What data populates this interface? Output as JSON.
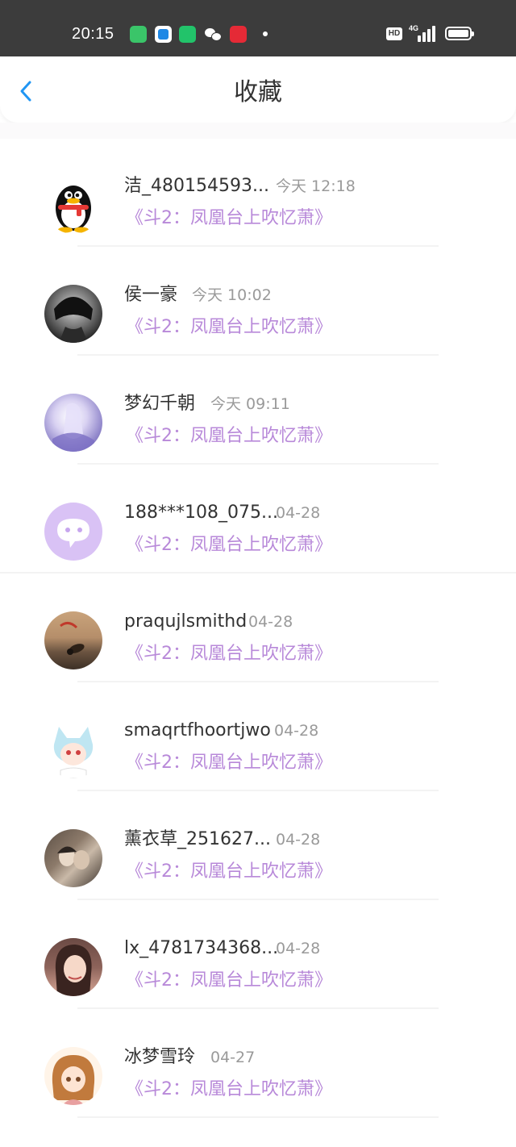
{
  "status_bar": {
    "time": "20:15",
    "hd": "HD",
    "network": "4G",
    "icons": [
      "app-store-icon",
      "browser-icon",
      "message-icon",
      "wechat-icon",
      "taobao-icon",
      "dot-icon",
      "hd-icon",
      "signal-icon",
      "battery-icon"
    ]
  },
  "nav": {
    "title": "收藏",
    "back_icon": "chevron-left-icon",
    "accent": "#2196f3"
  },
  "colors": {
    "book_title": "#b889d9",
    "name": "#333333",
    "time": "#9a9a9a"
  },
  "items": [
    {
      "name": "洁_480154593...",
      "time": "今天 12:18",
      "book": "《斗2：凤凰台上吹忆萧》",
      "avatar": "qq-penguin-avatar"
    },
    {
      "name": "侯一豪",
      "time": "今天 10:02",
      "book": "《斗2：凤凰台上吹忆萧》",
      "avatar": "anime-boy-avatar"
    },
    {
      "name": "梦幻千朝",
      "time": "今天 09:11",
      "book": "《斗2：凤凰台上吹忆萧》",
      "avatar": "fantasy-girl-avatar"
    },
    {
      "name": "188***108_075...",
      "time": "04-28",
      "book": "《斗2：凤凰台上吹忆萧》",
      "avatar": "default-chat-avatar"
    },
    {
      "name": "praqujlsmithd",
      "time": "04-28",
      "book": "《斗2：凤凰台上吹忆萧》",
      "avatar": "scenery-avatar"
    },
    {
      "name": "smaqrtfhoortjwo",
      "time": "04-28",
      "book": "《斗2：凤凰台上吹忆萧》",
      "avatar": "cat-boy-avatar"
    },
    {
      "name": "薰衣草_251627...",
      "time": "04-28",
      "book": "《斗2：凤凰台上吹忆萧》",
      "avatar": "couple-avatar"
    },
    {
      "name": "lx_4781734368...",
      "time": "04-28",
      "book": "《斗2：凤凰台上吹忆萧》",
      "avatar": "woman-avatar"
    },
    {
      "name": "冰梦雪玲",
      "time": "04-27",
      "book": "《斗2：凤凰台上吹忆萧》",
      "avatar": "anime-girl-avatar"
    }
  ]
}
